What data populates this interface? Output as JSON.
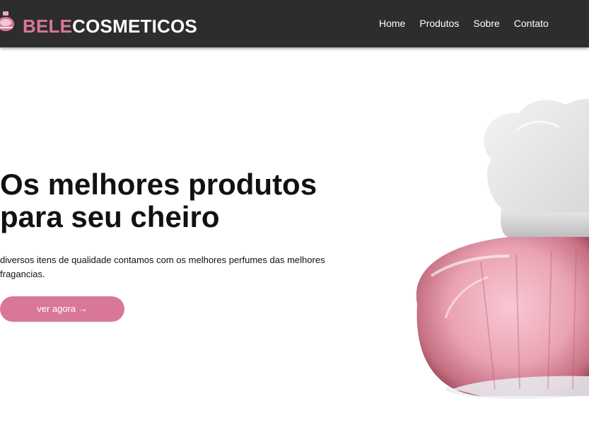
{
  "brand": {
    "part1": "BELE",
    "part2": "COSMETICOS"
  },
  "nav": {
    "items": [
      {
        "label": "Home"
      },
      {
        "label": "Produtos"
      },
      {
        "label": "Sobre"
      },
      {
        "label": "Contato"
      }
    ]
  },
  "hero": {
    "title_line1": "Os melhores produtos",
    "title_line2": "para seu cheiro",
    "description": "diversos itens de qualidade contamos com os melhores perfumes das melhores fragancias.",
    "cta_label": "ver agora →"
  },
  "colors": {
    "accent": "#d9779a",
    "navbar_bg": "#2d2d2d",
    "text": "#111111"
  },
  "icons": {
    "logo": "perfume-bottle-icon"
  }
}
